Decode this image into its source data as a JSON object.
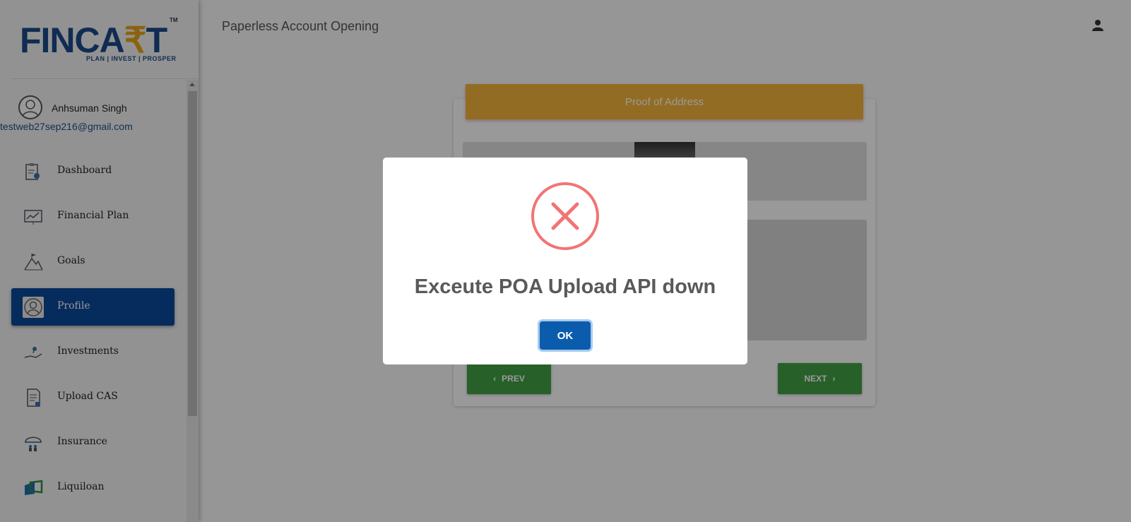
{
  "brand": {
    "logo_left": "FINCA",
    "logo_rupee": "₹",
    "logo_right": "T",
    "tm": "TM",
    "tagline": "PLAN | INVEST | PROSPER"
  },
  "user": {
    "name": "Anhsuman Singh",
    "email": "testweb27sep216@gmail.com"
  },
  "sidebar": {
    "items": [
      {
        "label": "Dashboard",
        "icon": "dashboard-icon"
      },
      {
        "label": "Financial Plan",
        "icon": "chart-icon"
      },
      {
        "label": "Goals",
        "icon": "mountain-icon"
      },
      {
        "label": "Profile",
        "icon": "profile-icon",
        "active": true
      },
      {
        "label": "Investments",
        "icon": "investment-icon"
      },
      {
        "label": "Upload CAS",
        "icon": "document-icon"
      },
      {
        "label": "Insurance",
        "icon": "umbrella-icon"
      },
      {
        "label": "Liquiloan",
        "icon": "liquiloan-icon"
      }
    ]
  },
  "header": {
    "title": "Paperless Account Opening"
  },
  "card": {
    "header": "Proof of Address",
    "prev_label": "PREV",
    "next_label": "NEXT"
  },
  "modal": {
    "title": "Exceute POA Upload API down",
    "ok_label": "OK",
    "icon": "error-x-icon"
  },
  "colors": {
    "brand_blue": "#0b4a9c",
    "accent_yellow": "#f4b53a",
    "success_green": "#43a047",
    "error_red": "#f27474"
  }
}
